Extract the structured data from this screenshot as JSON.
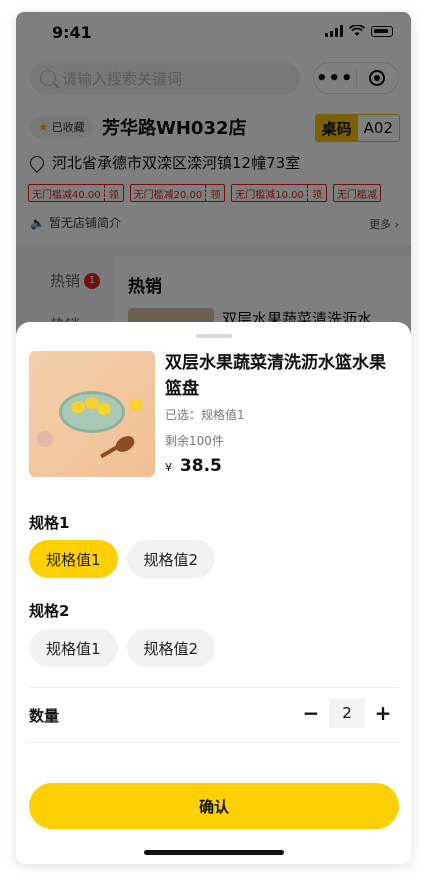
{
  "status": {
    "time": "9:41"
  },
  "search": {
    "placeholder": "请输入搜索关键词"
  },
  "capsule": {
    "more_icon": "ellipsis-icon",
    "target_icon": "record-icon"
  },
  "store": {
    "favorite_label": "已收藏",
    "name": "芳华路WH032店",
    "table_key": "桌码",
    "table_value": "A02",
    "address": "河北省承德市双滦区滦河镇12幢73室",
    "coupons": [
      {
        "text": "无门槛减40.00",
        "action": "领"
      },
      {
        "text": "无门槛减20.00",
        "action": "领"
      },
      {
        "text": "无门槛减10.00",
        "action": "领"
      },
      {
        "text": "无门槛减",
        "action": ""
      }
    ],
    "intro": "暂无店铺简介",
    "more": "更多 ›"
  },
  "menu": {
    "categories": [
      {
        "label": "热销",
        "badge": "1"
      },
      {
        "label": "热销"
      }
    ],
    "section_title": "热销",
    "first_product": "双层水果蔬菜清洗沥水篮..."
  },
  "sheet": {
    "title": "双层水果蔬菜清洗沥水篮水果篮盘",
    "selected": "已选：规格值1",
    "stock": "剩余100件",
    "currency": "¥",
    "price": "38.5",
    "spec_groups": [
      {
        "label": "规格1",
        "options": [
          "规格值1",
          "规格值2"
        ],
        "selected_index": 0
      },
      {
        "label": "规格2",
        "options": [
          "规格值1",
          "规格值2"
        ],
        "selected_index": -1
      }
    ],
    "quantity_label": "数量",
    "quantity": "2",
    "minus": "−",
    "plus": "+",
    "confirm": "确认"
  },
  "colors": {
    "accent": "#ffd000",
    "coupon_red": "#e02020",
    "badge_red": "#e02020"
  }
}
